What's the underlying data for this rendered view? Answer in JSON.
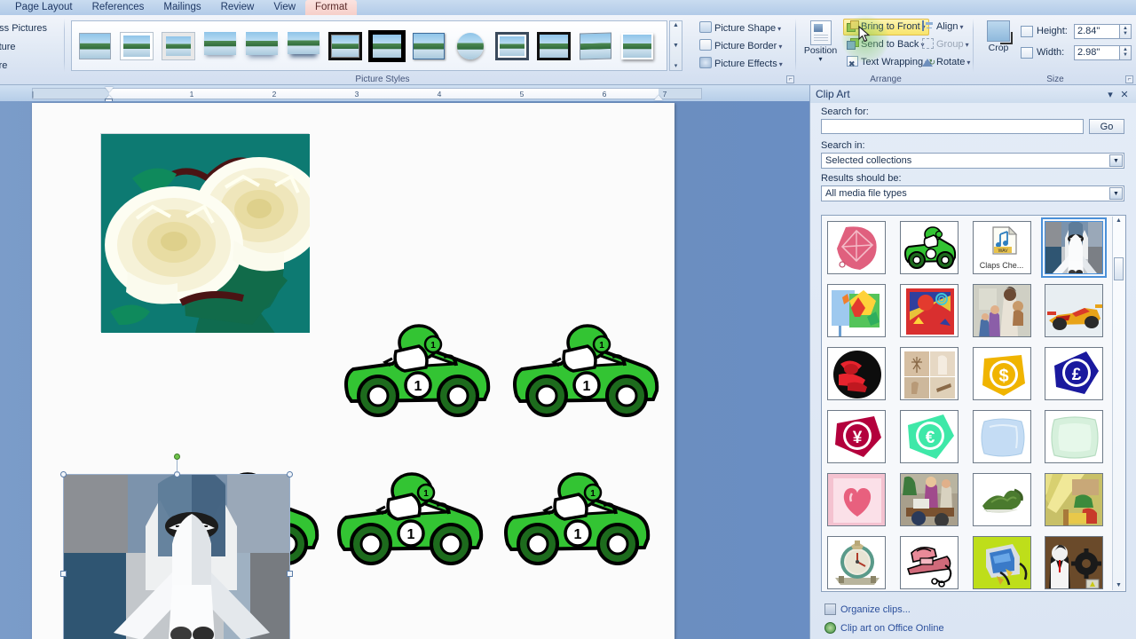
{
  "app": {
    "tabs": [
      {
        "label": "Page Layout",
        "active": false
      },
      {
        "label": "References",
        "active": false
      },
      {
        "label": "Mailings",
        "active": false
      },
      {
        "label": "Review",
        "active": false
      },
      {
        "label": "View",
        "active": false
      },
      {
        "label": "Format",
        "active": true
      }
    ]
  },
  "ribbon": {
    "adjust_group": {
      "items": [
        "ompress Pictures",
        "ge Picture",
        "t Picture"
      ]
    },
    "styles_group": {
      "label": "Picture Styles",
      "thumb_count": 14
    },
    "picture_group": {
      "shape": "Picture Shape",
      "border": "Picture Border",
      "effects": "Picture Effects"
    },
    "arrange_group": {
      "label": "Arrange",
      "position": "Position",
      "bring_to_front": "Bring to Front",
      "send_to_back": "Send to Back",
      "text_wrapping": "Text Wrapping",
      "align": "Align",
      "group": "Group",
      "rotate": "Rotate"
    },
    "size_group": {
      "label": "Size",
      "crop": "Crop",
      "height_label": "Height:",
      "height_value": "2.84\"",
      "width_label": "Width:",
      "width_value": "2.98\""
    }
  },
  "ruler": {
    "numbers": [
      "1",
      "2",
      "3",
      "4",
      "5",
      "6",
      "7"
    ]
  },
  "clip_art": {
    "title": "Clip Art",
    "search_for_label": "Search for:",
    "search_value": "",
    "go_label": "Go",
    "search_in_label": "Search in:",
    "search_in_value": "Selected collections",
    "results_label": "Results should be:",
    "results_value": "All media file types",
    "organize_link": "Organize clips...",
    "online_link": "Clip art on Office Online",
    "results": [
      {
        "name": "pink-kite",
        "caption": "",
        "selected": false
      },
      {
        "name": "green-race-car",
        "caption": "",
        "selected": false
      },
      {
        "name": "claps-cheer-wav",
        "caption": "Claps Che...",
        "selected": false
      },
      {
        "name": "space-shuttle",
        "caption": "",
        "selected": true
      },
      {
        "name": "colorful-collage",
        "caption": "",
        "selected": false
      },
      {
        "name": "stamp-art",
        "caption": "",
        "selected": false
      },
      {
        "name": "family-photo",
        "caption": "",
        "selected": false
      },
      {
        "name": "formula-race-car",
        "caption": "",
        "selected": false
      },
      {
        "name": "red-black-emblem",
        "caption": "",
        "selected": false
      },
      {
        "name": "tan-grid-collage",
        "caption": "",
        "selected": false
      },
      {
        "name": "dollar-coin",
        "caption": "",
        "selected": false
      },
      {
        "name": "pound-coin",
        "caption": "",
        "selected": false
      },
      {
        "name": "yen-coin",
        "caption": "",
        "selected": false
      },
      {
        "name": "euro-coin",
        "caption": "",
        "selected": false
      },
      {
        "name": "blue-pillow",
        "caption": "",
        "selected": false
      },
      {
        "name": "green-pillow",
        "caption": "",
        "selected": false
      },
      {
        "name": "pink-heart",
        "caption": "",
        "selected": false
      },
      {
        "name": "office-meeting",
        "caption": "",
        "selected": false
      },
      {
        "name": "green-leaf",
        "caption": "",
        "selected": false
      },
      {
        "name": "farm-harvest",
        "caption": "",
        "selected": false
      },
      {
        "name": "desk-clock",
        "caption": "",
        "selected": false
      },
      {
        "name": "clothes-iron",
        "caption": "",
        "selected": false
      },
      {
        "name": "computer-monitor",
        "caption": "",
        "selected": false
      },
      {
        "name": "business-gear",
        "caption": "",
        "selected": false
      }
    ]
  },
  "document": {
    "roses_image": "white-roses-clipart",
    "cars": [
      {
        "row": 1,
        "num": "1"
      },
      {
        "row": 1,
        "num": "1"
      },
      {
        "row": 2,
        "num": "1"
      },
      {
        "row": 2,
        "num": "1"
      },
      {
        "row": 2,
        "num": "1"
      }
    ],
    "selected_image": "space-shuttle-photo"
  },
  "colors": {
    "accent": "#4a90d9",
    "highlight": "#f8e46a",
    "car_green": "#3cc23c",
    "roses_bg": "#0d7a72"
  }
}
